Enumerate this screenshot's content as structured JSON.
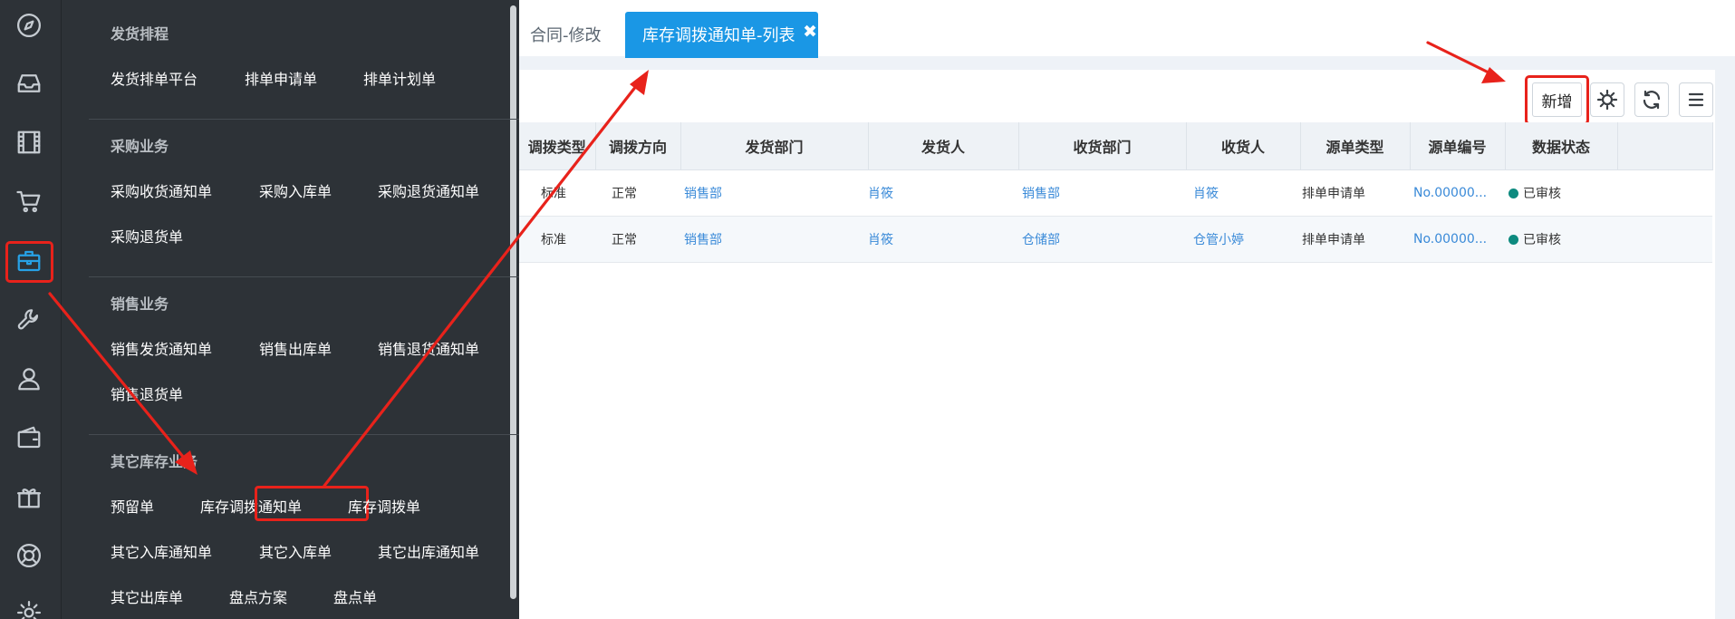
{
  "rail": {
    "icons": [
      "compass-icon",
      "inbox-icon",
      "film-icon",
      "cart-icon",
      "briefcase-icon",
      "wrench-icon",
      "user-icon",
      "wallet-icon",
      "gift-icon",
      "lifebuoy-icon",
      "gear-icon"
    ],
    "active": "briefcase-icon"
  },
  "menu": {
    "sections": [
      {
        "title": "发货排程",
        "items": [
          "发货排单平台",
          "排单申请单",
          "排单计划单"
        ]
      },
      {
        "title": "采购业务",
        "items": [
          "采购收货通知单",
          "采购入库单",
          "采购退货通知单",
          "采购退货单"
        ]
      },
      {
        "title": "销售业务",
        "items": [
          "销售发货通知单",
          "销售出库单",
          "销售退货通知单",
          "销售退货单"
        ]
      },
      {
        "title": "其它库存业务",
        "items": [
          "预留单",
          "库存调拨通知单",
          "库存调拨单",
          "其它入库通知单",
          "其它入库单",
          "其它出库通知单",
          "其它出库单",
          "盘点方案",
          "盘点单"
        ]
      }
    ]
  },
  "tabs": {
    "partial": "合同-修改",
    "active": "库存调拨通知单-列表",
    "close": "✖"
  },
  "toolbar": {
    "add_label": "新增"
  },
  "table": {
    "columns": [
      "调拨类型",
      "调拨方向",
      "发货部门",
      "发货人",
      "收货部门",
      "收货人",
      "源单类型",
      "源单编号",
      "数据状态"
    ],
    "rows": [
      [
        "标准",
        "正常",
        "销售部",
        "肖筱",
        "销售部",
        "肖筱",
        "排单申请单",
        "No.00000...",
        "已审核"
      ],
      [
        "标准",
        "正常",
        "销售部",
        "肖筱",
        "仓储部",
        "仓管小婷",
        "排单申请单",
        "No.00000...",
        "已审核"
      ]
    ]
  },
  "colors": {
    "accent": "#1a97e5",
    "annotation": "#e8221b",
    "status_ok": "#0d8a7f",
    "link": "#3a8ad8"
  }
}
